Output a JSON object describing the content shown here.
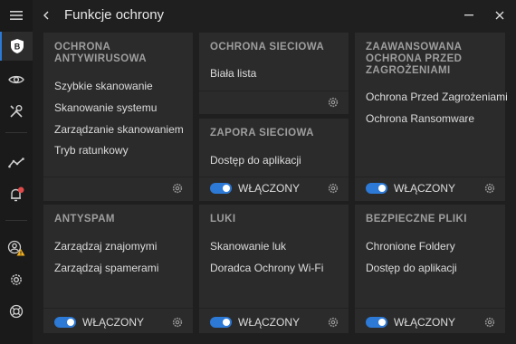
{
  "window": {
    "title": "Funkcje ochrony"
  },
  "sidebar": {
    "logo": "B",
    "items": [
      "menu-icon",
      "shield-b-icon",
      "eye-icon",
      "tools-icon",
      "activity-icon",
      "bell-icon",
      "user-warning-icon",
      "settings-icon",
      "help-icon"
    ],
    "accent": "#2c79d6",
    "notification_color": "#e04a4a",
    "warning_color": "#f2b01e"
  },
  "cards": {
    "antivirus": {
      "title_line1": "OCHRONA",
      "title_line2": "ANTYWIRUSOWA",
      "items": [
        "Szybkie skanowanie",
        "Skanowanie systemu",
        "Zarządzanie skanowaniem",
        "Tryb ratunkowy"
      ]
    },
    "network": {
      "title": "OCHRONA SIECIOWA",
      "items": [
        "Biała lista"
      ]
    },
    "firewall": {
      "title": "ZAPORA SIECIOWA",
      "items": [
        "Dostęp do aplikacji"
      ],
      "toggle_label": "WŁĄCZONY"
    },
    "advanced": {
      "title_line1": "ZAAWANSOWANA",
      "title_line2": "OCHRONA PRZED",
      "title_line3": "ZAGROŻENIAMI",
      "items": [
        "Ochrona Przed Zagrożeniami",
        "Ochrona Ransomware"
      ],
      "toggle_label": "WŁĄCZONY"
    },
    "antispam": {
      "title": "ANTYSPAM",
      "items": [
        "Zarządzaj znajomymi",
        "Zarządzaj spamerami"
      ],
      "toggle_label": "WŁĄCZONY"
    },
    "vuln": {
      "title": "LUKI",
      "items": [
        "Skanowanie luk",
        "Doradca Ochrony Wi-Fi"
      ],
      "toggle_label": "WŁĄCZONY"
    },
    "safefiles": {
      "title": "BEZPIECZNE PLIKI",
      "items": [
        "Chronione Foldery",
        "Dostęp do aplikacji"
      ],
      "toggle_label": "WŁĄCZONY"
    }
  },
  "toggle_color": "#2c79d6"
}
